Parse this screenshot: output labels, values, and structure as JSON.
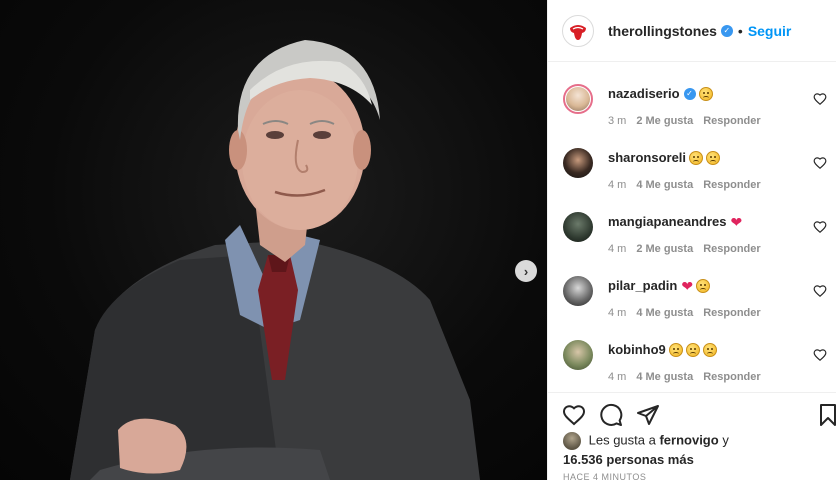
{
  "post": {
    "account": "therollingstones",
    "follow_label": "Seguir",
    "separator": "•",
    "photo_subject": "portrait",
    "next_arrow": "›"
  },
  "comments": [
    {
      "user": "nazadiserio",
      "verified": true,
      "emojis": [
        "sad"
      ],
      "time": "3 m",
      "likes": "2 Me gusta",
      "reply": "Responder"
    },
    {
      "user": "sharonsoreli",
      "verified": false,
      "emojis": [
        "sad",
        "sad"
      ],
      "time": "4 m",
      "likes": "4 Me gusta",
      "reply": "Responder"
    },
    {
      "user": "mangiapaneandres",
      "verified": false,
      "emojis": [
        "heart"
      ],
      "time": "4 m",
      "likes": "2 Me gusta",
      "reply": "Responder"
    },
    {
      "user": "pilar_padin",
      "verified": false,
      "emojis": [
        "heart",
        "sad"
      ],
      "time": "4 m",
      "likes": "4 Me gusta",
      "reply": "Responder"
    },
    {
      "user": "kobinho9",
      "verified": false,
      "emojis": [
        "sad",
        "sad",
        "sad"
      ],
      "time": "4 m",
      "likes": "4 Me gusta",
      "reply": "Responder"
    }
  ],
  "likes": {
    "prefix": "Les gusta a",
    "user": "fernovigo",
    "conjunction": "y",
    "count": "16.536 personas más"
  },
  "timestamp": "HACE 4 MINUTOS",
  "icons": {
    "like": "heart-outline-icon",
    "comment": "comment-bubble-icon",
    "share": "paper-plane-icon",
    "save": "bookmark-icon"
  },
  "colors": {
    "accent": "#0095f6",
    "verified": "#3897f0",
    "heart": "#e0245e",
    "muted": "#8e8e8e"
  }
}
